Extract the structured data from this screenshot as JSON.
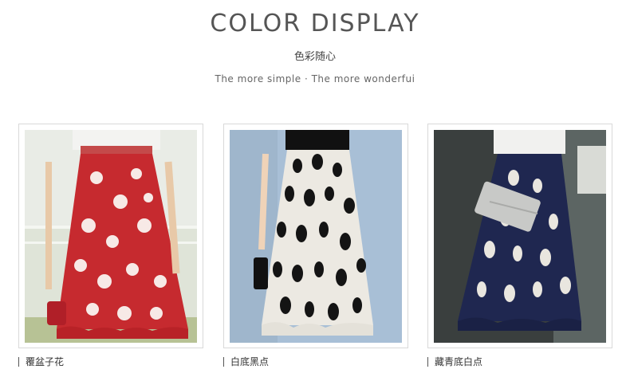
{
  "header": {
    "title": "COLOR DISPLAY",
    "subtitle": "色彩随心",
    "tagline": "The more simple · The more wonderfui"
  },
  "products": [
    {
      "caption": "覆盆子花",
      "skirt_color": "#c62a2f",
      "pattern": "white-flowers"
    },
    {
      "caption": "白底黑点",
      "skirt_color": "#ece9e2",
      "pattern": "black-dots"
    },
    {
      "caption": "藏青底白点",
      "skirt_color": "#1f2750",
      "pattern": "white-dots"
    }
  ]
}
